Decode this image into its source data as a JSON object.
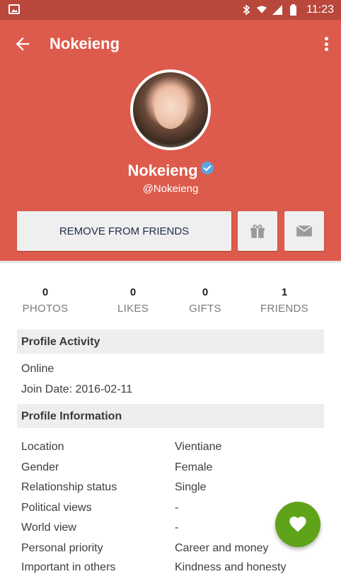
{
  "status_bar": {
    "time": "11:23"
  },
  "app_bar": {
    "title": "Nokeieng"
  },
  "profile": {
    "name": "Nokeieng",
    "handle": "@Nokeieng",
    "remove_button_label": "REMOVE FROM FRIENDS"
  },
  "stats": [
    {
      "value": "0",
      "label": "PHOTOS"
    },
    {
      "value": "0",
      "label": "LIKES"
    },
    {
      "value": "0",
      "label": "GIFTS"
    },
    {
      "value": "1",
      "label": "FRIENDS"
    }
  ],
  "activity": {
    "header": "Profile Activity",
    "status": "Online",
    "join_date": "Join Date: 2016-02-11"
  },
  "information": {
    "header": "Profile Information",
    "rows": [
      {
        "key": "Location",
        "value": "Vientiane"
      },
      {
        "key": "Gender",
        "value": "Female"
      },
      {
        "key": "Relationship status",
        "value": "Single"
      },
      {
        "key": "Political views",
        "value": "-"
      },
      {
        "key": "World view",
        "value": "-"
      },
      {
        "key": "Personal priority",
        "value": "Career and money"
      },
      {
        "key": "Important in others",
        "value": "Kindness and honesty"
      }
    ]
  },
  "colors": {
    "primary": "#dd5b4c",
    "status_bar": "#b9473c",
    "fab": "#5fa31a",
    "verified": "#5aa5e0"
  },
  "icons": [
    "image-icon",
    "bluetooth-icon",
    "wifi-icon",
    "signal-icon",
    "battery-icon",
    "back-arrow-icon",
    "more-vert-icon",
    "verified-icon",
    "gift-icon",
    "mail-icon",
    "heart-icon"
  ]
}
